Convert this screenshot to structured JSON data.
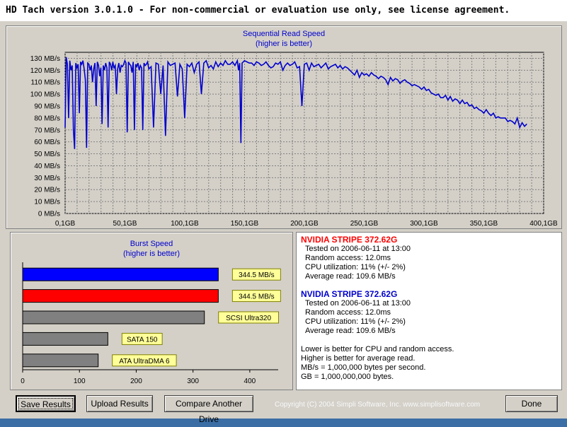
{
  "window": {
    "title": "HD Tach version 3.0.1.0  - For non-commercial or evaluation use only, see license agreement."
  },
  "sequential": {
    "title": "Sequential Read Speed",
    "subtitle": "(higher is better)",
    "chart_data": {
      "type": "line",
      "title": "Sequential Read Speed",
      "subtitle": "(higher is better)",
      "x_unit": "GB",
      "y_unit": "MB/s",
      "xlim": [
        0.1,
        400
      ],
      "ylim": [
        0,
        135
      ],
      "grid": true,
      "y_ticks": [
        "0 MB/s",
        "10 MB/s",
        "20 MB/s",
        "30 MB/s",
        "40 MB/s",
        "50 MB/s",
        "60 MB/s",
        "70 MB/s",
        "80 MB/s",
        "90 MB/s",
        "100 MB/s",
        "110 MB/s",
        "120 MB/s",
        "130 MB/s"
      ],
      "x_ticks": [
        "0,1GB",
        "50,1GB",
        "100,1GB",
        "150,1GB",
        "200,1GB",
        "250,1GB",
        "300,1GB",
        "350,1GB",
        "400,1GB"
      ],
      "series": [
        {
          "color": "#0000cc",
          "x": [
            0.1,
            1,
            2,
            3,
            4,
            5,
            6,
            7,
            8,
            9,
            10,
            11,
            12,
            13,
            14,
            15,
            16,
            17,
            18,
            19,
            20,
            21,
            22,
            23,
            24,
            25,
            26,
            27,
            28,
            29,
            30,
            31,
            32,
            33,
            34,
            35,
            36,
            37,
            38,
            39,
            40,
            41,
            42,
            43,
            44,
            45,
            46,
            47,
            48,
            49,
            50,
            51,
            52,
            53,
            54,
            55,
            56,
            57,
            58,
            59,
            60,
            61,
            62,
            63,
            64,
            65,
            66,
            67,
            68,
            69,
            70,
            72,
            74,
            76,
            78,
            80,
            82,
            84,
            86,
            88,
            90,
            92,
            94,
            96,
            98,
            100,
            102,
            104,
            106,
            108,
            110,
            112,
            114,
            116,
            118,
            120,
            122,
            124,
            126,
            128,
            130,
            132,
            134,
            136,
            138,
            140,
            142,
            144,
            145,
            146,
            147,
            148,
            150,
            152,
            154,
            156,
            158,
            160,
            162,
            164,
            166,
            168,
            170,
            172,
            174,
            176,
            178,
            180,
            182,
            184,
            186,
            188,
            190,
            192,
            194,
            196,
            198,
            200,
            202,
            204,
            206,
            208,
            210,
            212,
            214,
            216,
            218,
            220,
            222,
            224,
            226,
            228,
            230,
            232,
            234,
            236,
            238,
            240,
            242,
            244,
            246,
            248,
            250,
            252,
            254,
            256,
            258,
            260,
            262,
            264,
            266,
            268,
            270,
            272,
            274,
            276,
            278,
            280,
            282,
            284,
            286,
            288,
            290,
            292,
            294,
            296,
            298,
            300,
            302,
            304,
            306,
            308,
            310,
            312,
            314,
            316,
            318,
            320,
            322,
            324,
            326,
            328,
            330,
            332,
            334,
            336,
            338,
            340,
            342,
            344,
            346,
            348,
            350,
            352,
            354,
            356,
            358,
            360,
            362,
            364,
            366,
            368,
            370,
            372,
            374,
            376,
            378,
            380,
            382,
            384,
            386,
            388,
            390,
            392,
            394,
            396,
            398,
            400
          ],
          "y": [
            72,
            131,
            125,
            80,
            128,
            120,
            124,
            70,
            54,
            126,
            122,
            125,
            84,
            127,
            125,
            128,
            121,
            112,
            55,
            126,
            125,
            120,
            124,
            110,
            121,
            126,
            90,
            127,
            124,
            115,
            122,
            75,
            124,
            120,
            126,
            122,
            72,
            127,
            125,
            120,
            127,
            122,
            124,
            100,
            121,
            126,
            118,
            124,
            123,
            125,
            128,
            126,
            68,
            127,
            125,
            124,
            118,
            127,
            70,
            125,
            123,
            126,
            120,
            124,
            122,
            70,
            126,
            124,
            125,
            127,
            121,
            123,
            72,
            126,
            125,
            100,
            124,
            65,
            127,
            124,
            125,
            126,
            98,
            125,
            121,
            80,
            125,
            123,
            126,
            118,
            125,
            127,
            100,
            126,
            128,
            122,
            124,
            121,
            127,
            123,
            126,
            124,
            128,
            125,
            125,
            127,
            124,
            128,
            120,
            126,
            59,
            126,
            128,
            127,
            126,
            126,
            124,
            127,
            126,
            124,
            125,
            127,
            124,
            122,
            123,
            126,
            125,
            127,
            120,
            124,
            126,
            124,
            125,
            127,
            122,
            123,
            90,
            125,
            126,
            120,
            126,
            123,
            124,
            125,
            122,
            124,
            126,
            121,
            123,
            124,
            125,
            122,
            124,
            121,
            123,
            122,
            120,
            118,
            116,
            120,
            114,
            118,
            116,
            117,
            115,
            118,
            116,
            115,
            113,
            115,
            114,
            112,
            108,
            114,
            111,
            113,
            112,
            109,
            111,
            112,
            110,
            109,
            107,
            108,
            107,
            106,
            104,
            106,
            103,
            104,
            101,
            100,
            99,
            100,
            97,
            97,
            99,
            95,
            98,
            94,
            96,
            95,
            92,
            95,
            92,
            93,
            90,
            91,
            88,
            89,
            87,
            86,
            84,
            87,
            84,
            82,
            84,
            80,
            81,
            80,
            80,
            80,
            77,
            78,
            77,
            75,
            80,
            72,
            76,
            73,
            75
          ]
        }
      ]
    }
  },
  "burst": {
    "title": "Burst Speed",
    "subtitle": "(higher is better)",
    "chart_data": {
      "type": "bar",
      "orientation": "horizontal",
      "title": "Burst Speed",
      "subtitle": "(higher is better)",
      "xlim": [
        0,
        450
      ],
      "x_ticks": [
        "0",
        "100",
        "200",
        "300",
        "400"
      ],
      "bars": [
        {
          "label": "344.5 MB/s",
          "value": 344.5,
          "color": "#0000ff"
        },
        {
          "label": "344.5 MB/s",
          "value": 344.5,
          "color": "#ff0000"
        },
        {
          "label": "SCSI Ultra320",
          "value": 320,
          "color": "#808080"
        },
        {
          "label": "SATA 150",
          "value": 150,
          "color": "#808080"
        },
        {
          "label": "ATA UltraDMA 6",
          "value": 133,
          "color": "#808080"
        }
      ]
    }
  },
  "results": [
    {
      "name": "NVIDIA STRIPE  372.62G",
      "color": "#ff0000",
      "tested": "Tested on 2006-06-11 at 13:00",
      "random": "Random access: 12.0ms",
      "cpu": "CPU utilization: 11% (+/- 2%)",
      "avg": "Average read: 109.6 MB/s"
    },
    {
      "name": "NVIDIA STRIPE  372.62G",
      "color": "#0000cc",
      "tested": "Tested on 2006-06-11 at 13:00",
      "random": "Random access: 12.0ms",
      "cpu": "CPU utilization: 11% (+/- 2%)",
      "avg": "Average read: 109.6 MB/s"
    }
  ],
  "notes": [
    "Lower is better for CPU and random access.",
    "Higher is better for average read.",
    "MB/s = 1,000,000 bytes per second.",
    "GB = 1,000,000,000 bytes."
  ],
  "buttons": {
    "save": "Save Results",
    "upload": "Upload Results",
    "compare": "Compare Another Drive",
    "done": "Done"
  },
  "copyright": "Copyright (C) 2004 Simpli Software, Inc. www.simplisoftware.com"
}
